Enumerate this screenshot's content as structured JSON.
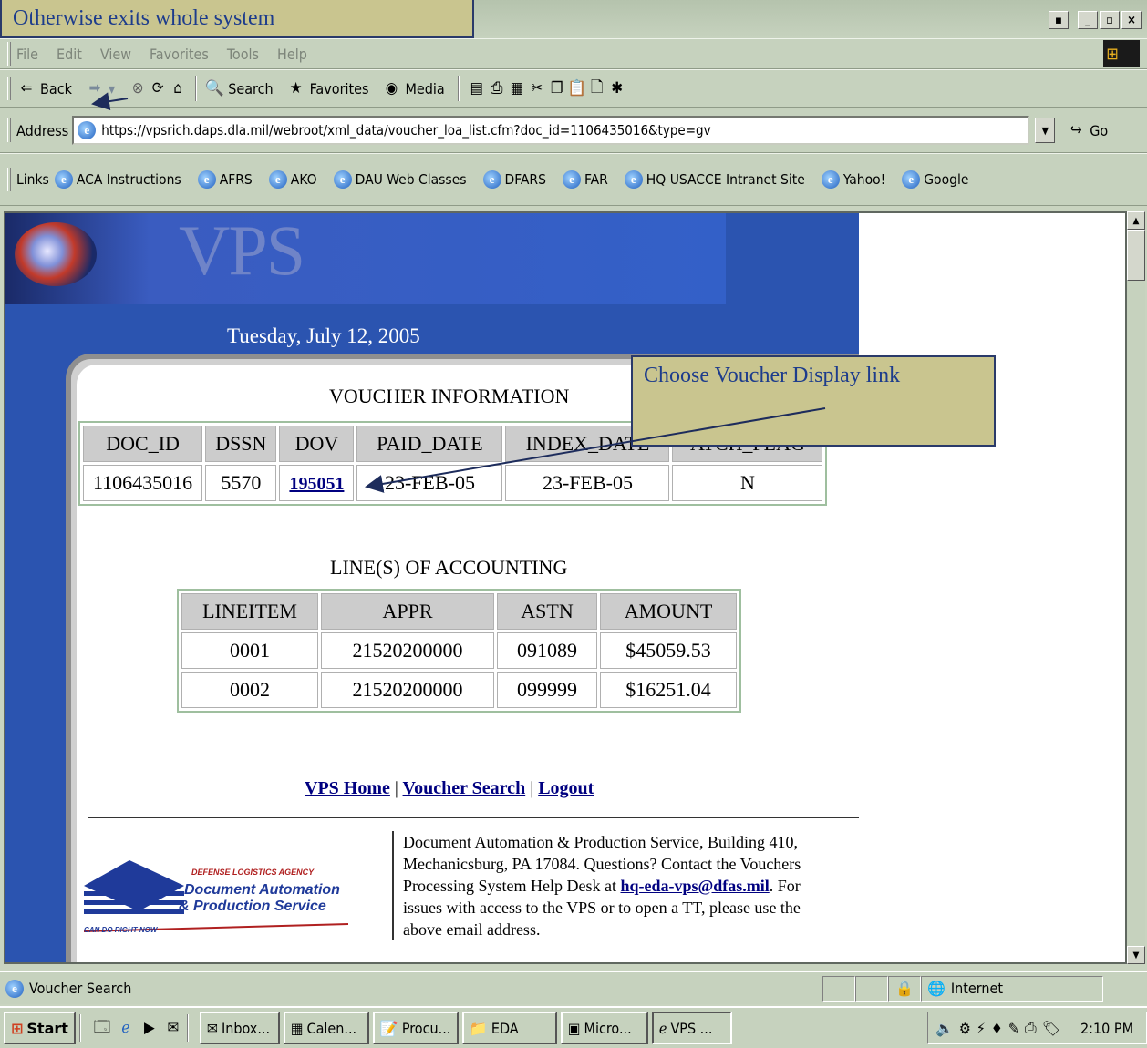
{
  "callouts": {
    "back_note": "Otherwise exits whole system",
    "voucher_note": "Choose Voucher Display link"
  },
  "menu": [
    "File",
    "Edit",
    "View",
    "Favorites",
    "Tools",
    "Help"
  ],
  "toolbar": {
    "back": "Back",
    "search": "Search",
    "favorites": "Favorites",
    "media": "Media"
  },
  "address": {
    "label": "Address",
    "url": "https://vpsrich.daps.dla.mil/webroot/xml_data/voucher_loa_list.cfm?doc_id=1106435016&type=gv",
    "go": "Go"
  },
  "links": {
    "label": "Links",
    "items": [
      "ACA Instructions",
      "AFRS",
      "AKO",
      "DAU Web Classes",
      "DFARS",
      "FAR",
      "HQ USACCE Intranet Site",
      "Yahoo!",
      "Google"
    ]
  },
  "page": {
    "logo": "VPS",
    "date": "Tuesday, July 12, 2005",
    "voucher_title": "VOUCHER INFORMATION",
    "voucher_headers": [
      "DOC_ID",
      "DSSN",
      "DOV",
      "PAID_DATE",
      "INDEX_DATE",
      "ATCH_FLAG"
    ],
    "voucher_row": [
      "1106435016",
      "5570",
      "195051",
      "23-FEB-05",
      "23-FEB-05",
      "N"
    ],
    "loa_title": "LINE(S) OF ACCOUNTING",
    "loa_headers": [
      "LINEITEM",
      "APPR",
      "ASTN",
      "AMOUNT"
    ],
    "loa_rows": [
      [
        "0001",
        "21520200000",
        "091089",
        "$45059.53"
      ],
      [
        "0002",
        "21520200000",
        "099999",
        "$16251.04"
      ]
    ],
    "nav": {
      "home": "VPS Home",
      "search": "Voucher Search",
      "logout": "Logout",
      "sep": "|"
    },
    "footer": {
      "text1": "Document Automation & Production Service, Building 410, Mechanicsburg, PA 17084. Questions? Contact the Vouchers Processing System Help Desk at ",
      "email": "hq-eda-vps@dfas.mil",
      "text2": ". For issues with access to the VPS or to open a TT, please use the above email address."
    },
    "dla_logo": {
      "agency": "DEFENSE LOGISTICS AGENCY",
      "name1": "Document Automation",
      "name2": "& Production Service",
      "motto": "CAN DO RIGHT NOW"
    }
  },
  "status": {
    "text": "Voucher Search",
    "zone": "Internet"
  },
  "taskbar": {
    "start": "Start",
    "tasks": [
      "Inbox...",
      "Calen...",
      "Procu...",
      "EDA",
      "Micro...",
      "VPS ..."
    ],
    "clock": "2:10 PM"
  }
}
